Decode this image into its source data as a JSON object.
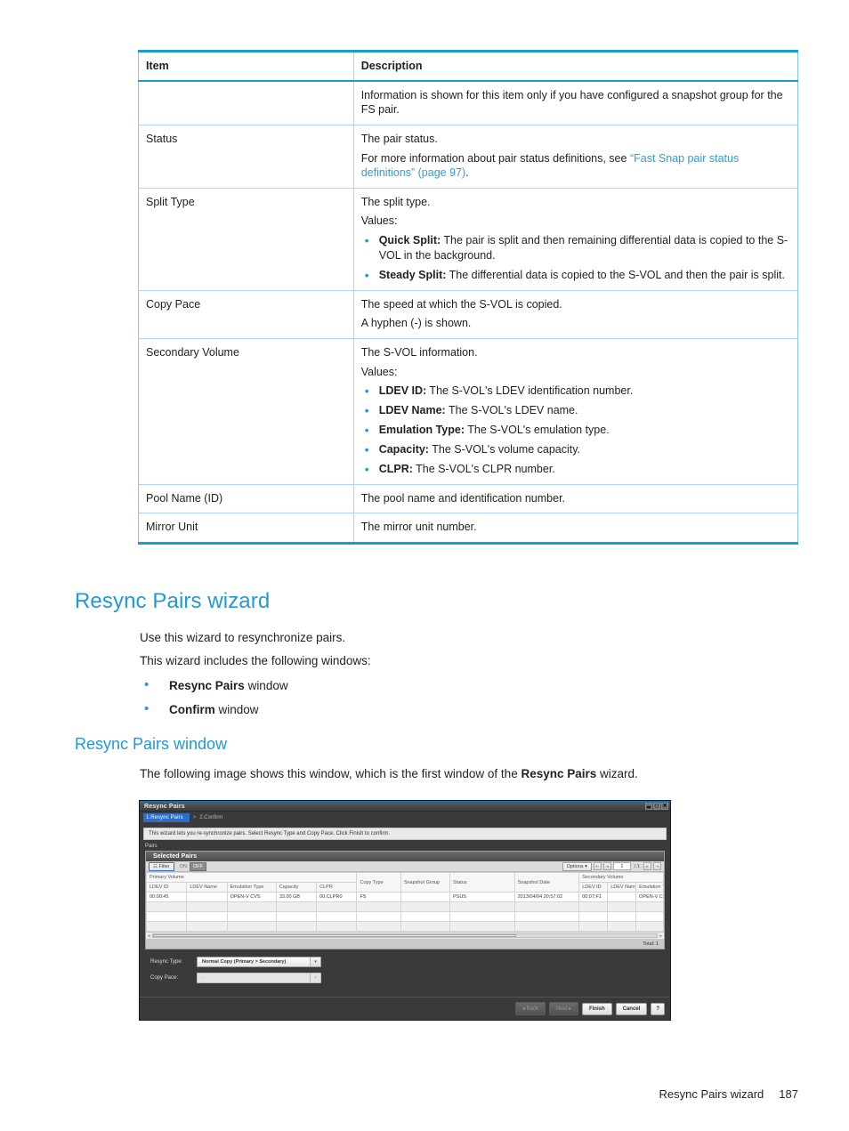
{
  "doc": {
    "table": {
      "headers": [
        "Item",
        "Description"
      ],
      "rows": [
        {
          "item": "",
          "paras": [
            "Information is shown for this item only if you have configured a snapshot group for the FS pair."
          ],
          "bullets": []
        },
        {
          "item": "Status",
          "paras": [
            "The pair status."
          ],
          "link_para": {
            "pre": "For more information about pair status definitions, see ",
            "link": "“Fast Snap pair status definitions” (page 97)",
            "post": "."
          },
          "bullets": []
        },
        {
          "item": "Split Type",
          "paras": [
            "The split type.",
            "Values:"
          ],
          "bullets": [
            {
              "label": "Quick Split:",
              "text": " The pair is split and then remaining differential data is copied to the S-VOL in the background."
            },
            {
              "label": "Steady Split:",
              "text": " The differential data is copied to the S-VOL and then the pair is split."
            }
          ]
        },
        {
          "item": "Copy Pace",
          "paras": [
            "The speed at which the S-VOL is copied.",
            "A hyphen (-) is shown."
          ],
          "bullets": []
        },
        {
          "item": "Secondary Volume",
          "paras": [
            "The S-VOL information.",
            "Values:"
          ],
          "bullets": [
            {
              "label": "LDEV ID:",
              "text": " The S-VOL's LDEV identification number."
            },
            {
              "label": "LDEV Name:",
              "text": " The S-VOL's LDEV name."
            },
            {
              "label": "Emulation Type:",
              "text": " The S-VOL's emulation type."
            },
            {
              "label": "Capacity:",
              "text": " The S-VOL's volume capacity."
            },
            {
              "label": "CLPR:",
              "text": " The S-VOL's CLPR number."
            }
          ]
        },
        {
          "item": "Pool Name (ID)",
          "paras": [
            "The pool name and identification number."
          ],
          "bullets": []
        },
        {
          "item": "Mirror Unit",
          "paras": [
            "The mirror unit number."
          ],
          "bullets": []
        }
      ]
    },
    "heading1": "Resync Pairs wizard",
    "intro1": "Use this wizard to resynchronize pairs.",
    "intro2": "This wizard includes the following windows:",
    "wizard_windows": [
      {
        "bold": "Resync Pairs",
        "rest": " window"
      },
      {
        "bold": "Confirm",
        "rest": " window"
      }
    ],
    "heading2": "Resync Pairs window",
    "figure_intro": {
      "pre": "The following image shows this window, which is the first window of the ",
      "bold": "Resync Pairs",
      "post": " wizard."
    },
    "footer": {
      "title": "Resync Pairs wizard",
      "page": "187"
    }
  },
  "app": {
    "title": "Resync Pairs",
    "window_controls": [
      "minimize-icon",
      "maximize-icon",
      "close-icon"
    ],
    "tabs": {
      "active": "1.Resync Pairs",
      "separator": ">",
      "inactive": "2.Confirm"
    },
    "instruction": "This wizard lets you re-synchronize pairs. Select Resync Type and Copy Pace. Click Finish to confirm.",
    "section_label": "Pairs",
    "panel": {
      "title": "Selected Pairs",
      "filter_button": "Filter",
      "toggle_on": "ON",
      "toggle_off": "OFF",
      "options_button": "Options",
      "page_value": "1",
      "page_total": "/ 1",
      "total_label": "Total: 1"
    },
    "grid": {
      "group_headers": [
        {
          "label": "Primary Volume",
          "span": 5
        },
        {
          "label": "Copy Type",
          "span": 1,
          "rowspan": true
        },
        {
          "label": "Snapshot Group",
          "span": 1,
          "rowspan": true
        },
        {
          "label": "Status",
          "span": 1,
          "rowspan": true
        },
        {
          "label": "Snapshot Date",
          "span": 1,
          "rowspan": true
        },
        {
          "label": "Secondary Volume",
          "span": 3
        }
      ],
      "sub_headers_primary": [
        "LDEV ID",
        "LDEV Name",
        "Emulation Type",
        "Capacity",
        "CLPR"
      ],
      "sub_headers_secondary": [
        "LDEV ID",
        "LDEV Name",
        "Emulation Type"
      ],
      "rows": [
        {
          "p_ldev_id": "00:00:45",
          "p_ldev_name": "",
          "p_emulation": "OPEN-V CVS",
          "p_capacity": "33.00 GB",
          "p_clpr": "00:CLPR0",
          "copy_type": "FS",
          "snapshot_group": "",
          "status": "PSUS",
          "snapshot_date": "2013/04/04 20:57:02",
          "s_ldev_id": "00:07:F1",
          "s_ldev_name": "",
          "s_emulation": "OPEN-V CVS"
        }
      ],
      "empty_rows": 3
    },
    "form": {
      "resync_type_label": "Resync Type:",
      "resync_type_value": "Normal Copy (Primary > Secondary)",
      "copy_pace_label": "Copy Pace:",
      "copy_pace_value": "-"
    },
    "buttons": {
      "back": "Back",
      "next": "Next",
      "finish": "Finish",
      "cancel": "Cancel",
      "help": "?"
    },
    "colors": {
      "accent_blue": "#2d6fc4",
      "chrome": "#3a3a3c"
    }
  }
}
